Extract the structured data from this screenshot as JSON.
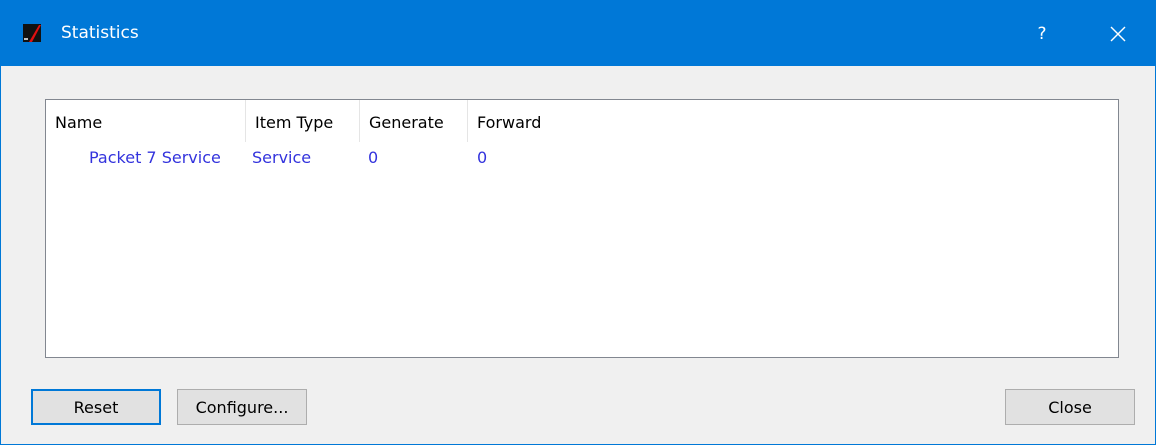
{
  "window": {
    "title": "Statistics",
    "help_label": "?",
    "accent_color": "#0078d7"
  },
  "table": {
    "columns": [
      "Name",
      "Item Type",
      "Generate",
      "Forward"
    ],
    "rows": [
      {
        "name": "Packet 7 Service",
        "item_type": "Service",
        "generate": "0",
        "forward": "0"
      }
    ],
    "row_text_color": "#3333dd"
  },
  "buttons": {
    "reset": "Reset",
    "configure": "Configure...",
    "close": "Close"
  }
}
